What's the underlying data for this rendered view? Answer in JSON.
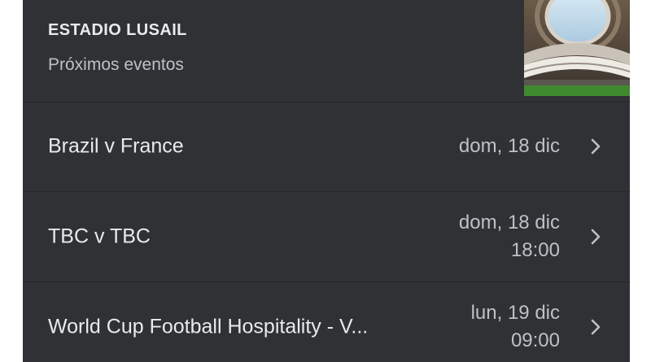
{
  "venue": {
    "name": "ESTADIO LUSAIL",
    "subtitle": "Próximos eventos"
  },
  "events": [
    {
      "title": "Brazil v France",
      "date": "dom, 18 dic",
      "time": ""
    },
    {
      "title": "TBC v TBC",
      "date": "dom, 18 dic",
      "time": "18:00"
    },
    {
      "title": "World Cup Football Hospitality - V...",
      "date": "lun, 19 dic",
      "time": "09:00"
    }
  ],
  "icons": {
    "row_chevron": "chevron-right-icon",
    "venue_image": "stadium-image"
  },
  "colors": {
    "card_background": "#303134",
    "divider": "#26272a",
    "primary_text": "#e8eaed",
    "secondary_text": "#bdc1c6"
  }
}
